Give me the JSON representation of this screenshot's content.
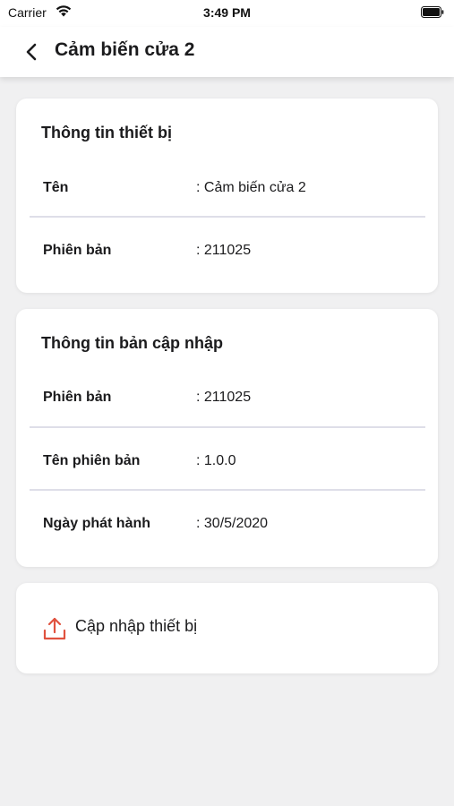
{
  "status_bar": {
    "carrier": "Carrier",
    "time": "3:49 PM",
    "icons": [
      "wifi-icon",
      "battery-icon"
    ]
  },
  "nav": {
    "back_icon": "chevron-left-icon",
    "title": "Cảm biến cửa 2"
  },
  "device_info": {
    "title": "Thông tin thiết bị",
    "rows": [
      {
        "label": "Tên",
        "value": ": Cảm biến cửa 2"
      },
      {
        "label": "Phiên bản",
        "value": ": 211025"
      }
    ]
  },
  "update_info": {
    "title": "Thông tin bản cập nhập",
    "rows": [
      {
        "label": "Phiên bản",
        "value": ": 211025"
      },
      {
        "label": "Tên phiên bản",
        "value": ": 1.0.0"
      },
      {
        "label": "Ngày phát hành",
        "value": ": 30/5/2020"
      }
    ]
  },
  "update_action": {
    "icon": "upload-icon",
    "label": "Cập nhập thiết bị",
    "icon_color": "#e0523f"
  },
  "colors": {
    "background": "#f0f0f1",
    "card": "#ffffff",
    "divider": "#dedee8",
    "text": "#1b1b1d"
  }
}
